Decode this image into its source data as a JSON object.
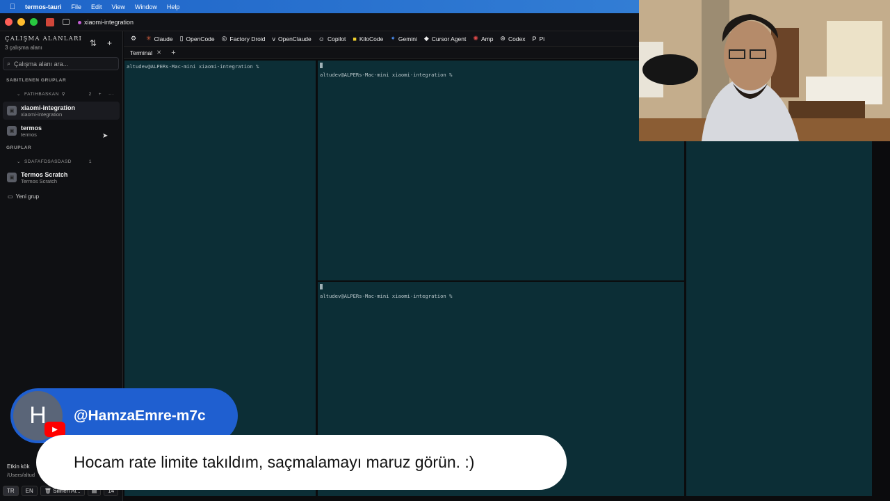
{
  "menubar": {
    "app_name": "termos-tauri",
    "items": [
      "File",
      "Edit",
      "View",
      "Window",
      "Help"
    ]
  },
  "window": {
    "title": "xiaomi-integration"
  },
  "sidebar": {
    "heading": "ÇALIŞMA ALANLARI",
    "count": "3 çalışma alanı",
    "search_placeholder": "Çalışma alanı ara...",
    "pinned_label": "SABITLENEN GRUPLAR",
    "pinned_group": {
      "name": "FATIHBASKAN",
      "count": "2"
    },
    "pinned_items": [
      {
        "title": "xiaomi-integration",
        "subtitle": "xiaomi-integration"
      },
      {
        "title": "termos",
        "subtitle": "termos"
      }
    ],
    "groups_label": "GRUPLAR",
    "group": {
      "name": "SDAFAFDSASDASD",
      "count": "1"
    },
    "group_items": [
      {
        "title": "Termos Scratch",
        "subtitle": "Termos Scratch"
      }
    ],
    "new_group": "Yeni grup",
    "footer_root": "Etkin kök",
    "footer_path": "/Users/altud",
    "lang_tr": "TR",
    "lang_en": "EN",
    "deleted": "Silinen Al...",
    "num": "14"
  },
  "agents": [
    "Claude",
    "OpenCode",
    "Factory Droid",
    "OpenClaude",
    "Copilot",
    "KiloCode",
    "Gemini",
    "Cursor Agent",
    "Amp",
    "Codex",
    "Pi"
  ],
  "tabs": {
    "active": "Terminal"
  },
  "terminal": {
    "prompt": "altudev@ALPERs-Mac-mini xiaomi-integration %"
  },
  "overlay": {
    "avatar_letter": "H",
    "handle": "@HamzaEmre-m7c",
    "comment": "Hocam rate limite takıldım, saçmalamayı maruz görün. :)"
  }
}
